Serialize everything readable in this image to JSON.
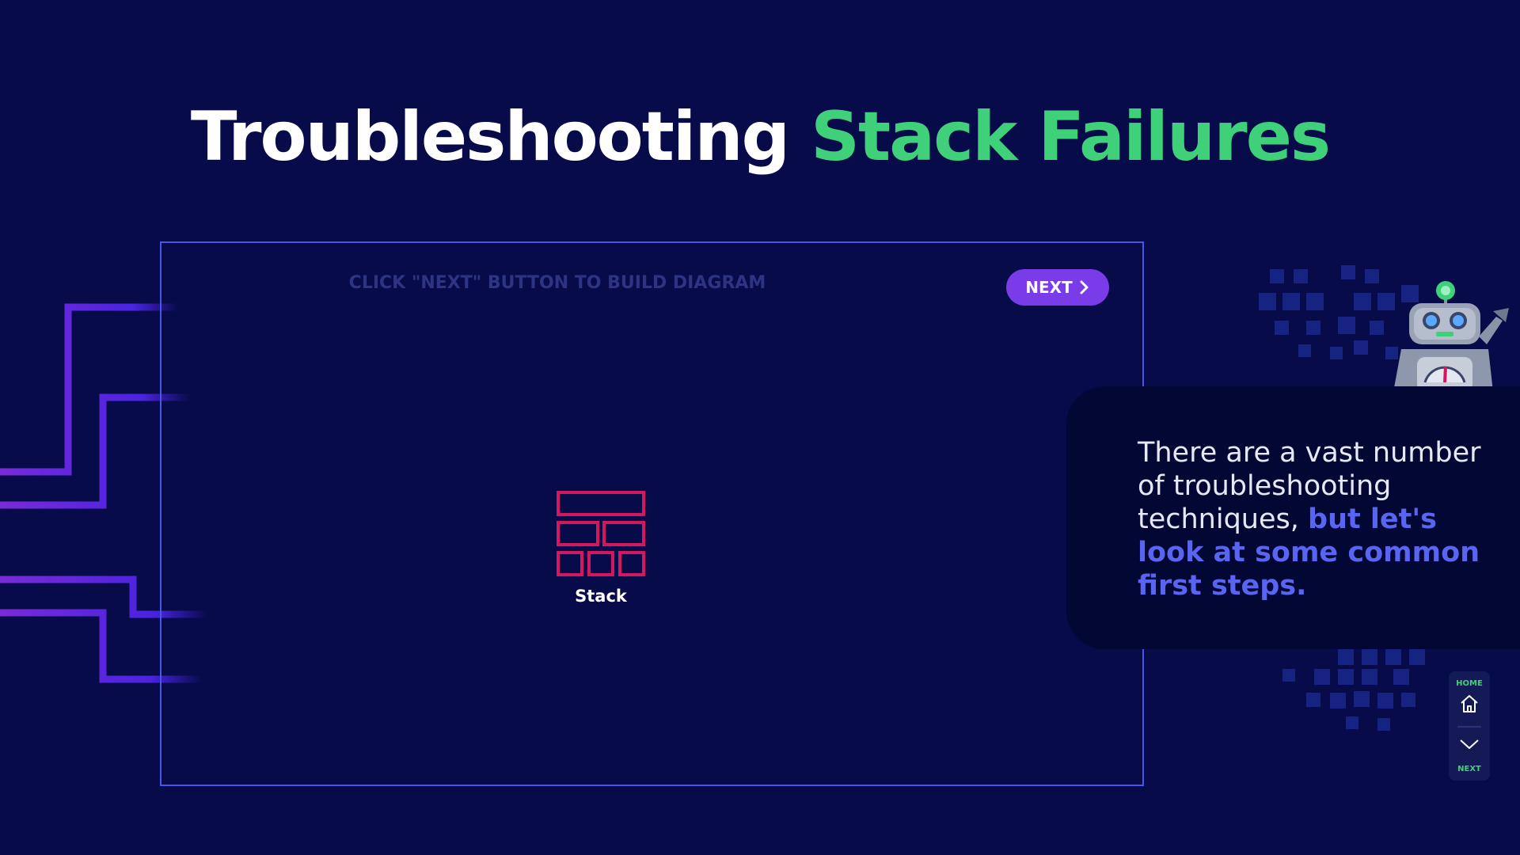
{
  "title": {
    "main": "Troubleshooting",
    "accent": "Stack Failures"
  },
  "diagram": {
    "hint": "CLICK \"NEXT\" BUTTON TO BUILD DIAGRAM",
    "next_label": "NEXT",
    "node_label": "Stack",
    "node_icon": "stack-bricks-icon"
  },
  "panel": {
    "text_plain": "There are a vast number of troubleshooting techniques, ",
    "text_highlight": "but let's look at some common first steps."
  },
  "nav": {
    "home_label": "HOME",
    "next_label": "NEXT"
  },
  "colors": {
    "background": "#070b4a",
    "accent_green": "#3fd07a",
    "frame_border": "#4a57e6",
    "button": "#7a3be8",
    "stack_icon": "#d4185f",
    "highlight": "#5865f2",
    "circuit": "#6a2be0"
  }
}
